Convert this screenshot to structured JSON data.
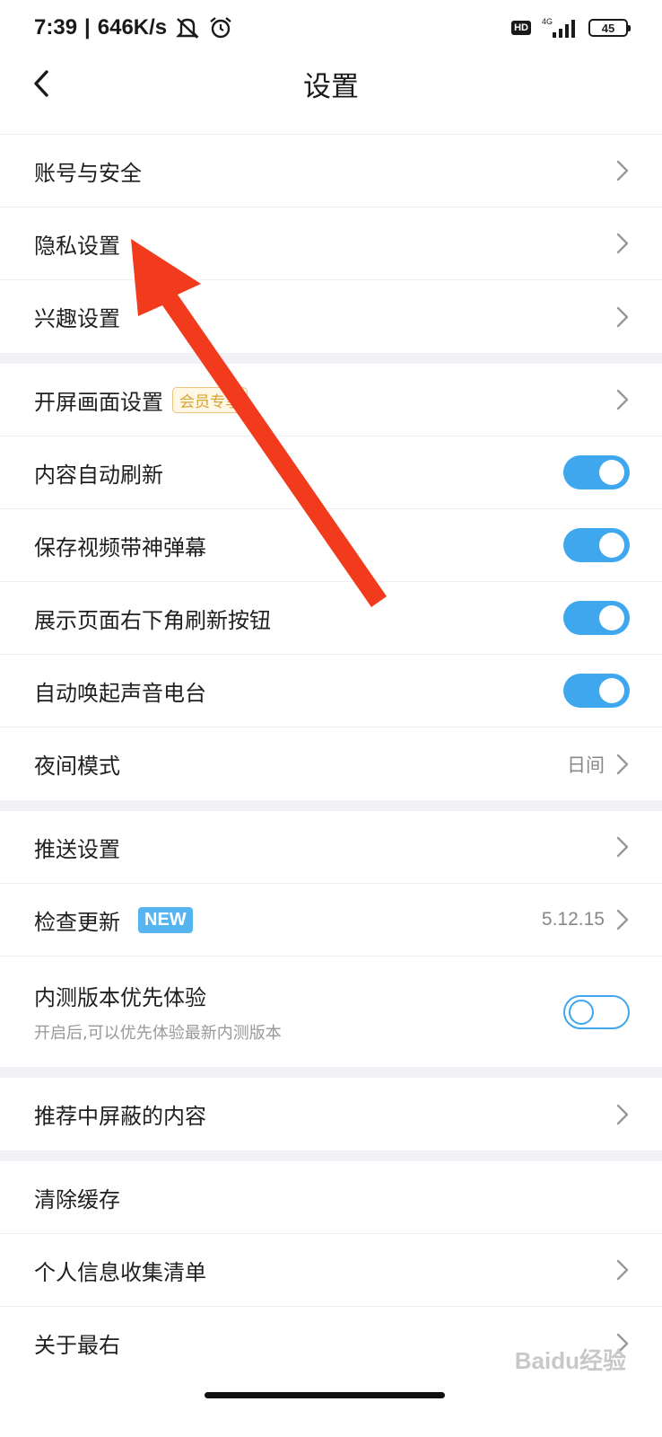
{
  "status_bar": {
    "time": "7:39",
    "speed": "646K/s",
    "hd": "HD",
    "network": "4G",
    "battery": "45"
  },
  "header": {
    "title": "设置"
  },
  "sections": {
    "s1": {
      "account": "账号与安全",
      "privacy": "隐私设置",
      "interest": "兴趣设置"
    },
    "s2": {
      "splash": "开屏画面设置",
      "vip_badge": "会员专享",
      "auto_refresh": "内容自动刷新",
      "save_danmaku": "保存视频带神弹幕",
      "show_refresh": "展示页面右下角刷新按钮",
      "auto_radio": "自动唤起声音电台",
      "night_mode": "夜间模式",
      "night_value": "日间"
    },
    "s3": {
      "push": "推送设置",
      "check_update": "检查更新",
      "new_badge": "NEW",
      "version": "5.12.15",
      "beta": "内测版本优先体验",
      "beta_desc": "开启后,可以优先体验最新内测版本"
    },
    "s4": {
      "blocked": "推荐中屏蔽的内容"
    },
    "s5": {
      "clear_cache": "清除缓存",
      "personal_info": "个人信息收集清单",
      "about": "关于最右"
    }
  },
  "toggles": {
    "auto_refresh": true,
    "save_danmaku": true,
    "show_refresh": true,
    "auto_radio": true,
    "beta": false
  },
  "colors": {
    "accent": "#3fa7ee",
    "annotation_arrow": "#f23a1c",
    "new_badge": "#56b4f0",
    "vip": "#d8a334"
  },
  "watermark": "Baidu经验"
}
